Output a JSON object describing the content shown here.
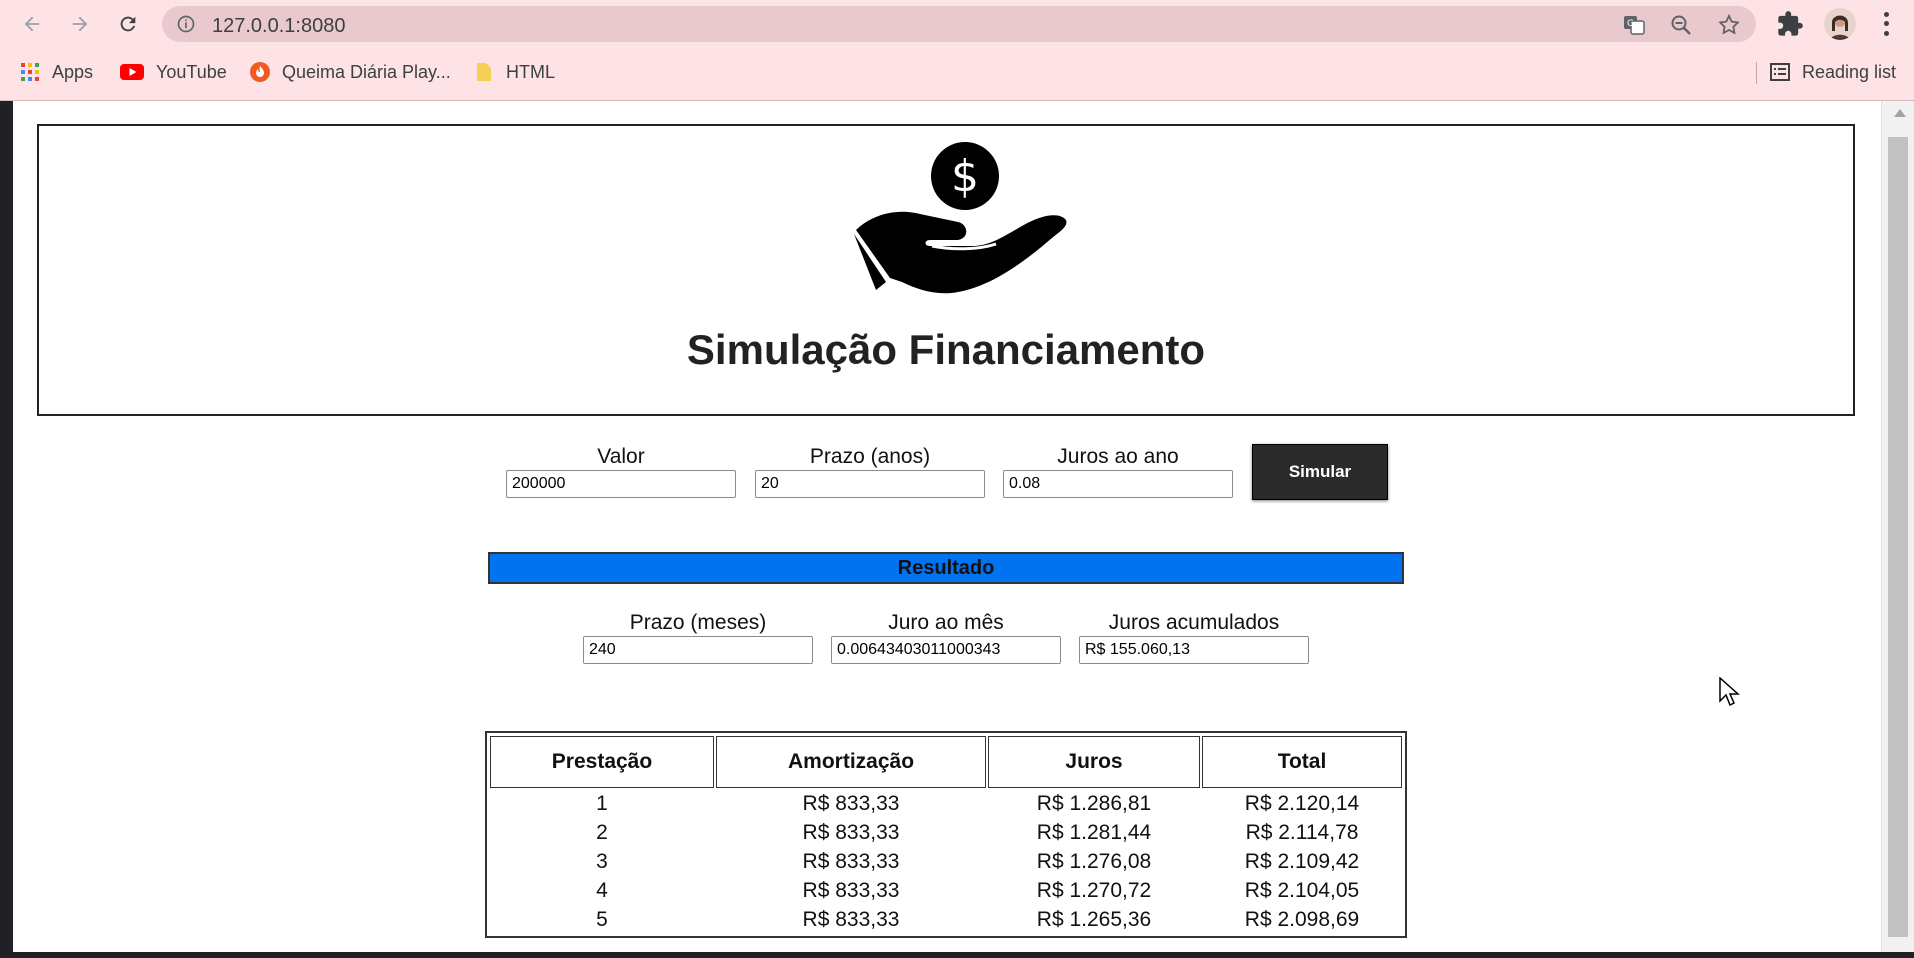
{
  "browser": {
    "url": "127.0.0.1:8080",
    "bookmarks": [
      {
        "label": "Apps",
        "icon": "apps-grid-icon"
      },
      {
        "label": "YouTube",
        "icon": "youtube-icon"
      },
      {
        "label": "Queima Diária Play...",
        "icon": "flame-icon"
      },
      {
        "label": "HTML",
        "icon": "folder-icon"
      }
    ],
    "reading_list": "Reading list"
  },
  "header": {
    "title": "Simulação Financiamento",
    "icon": "hand-money-icon"
  },
  "form": {
    "valor": {
      "label": "Valor",
      "value": "200000"
    },
    "prazo_anos": {
      "label": "Prazo (anos)",
      "value": "20"
    },
    "juros_ano": {
      "label": "Juros ao ano",
      "value": "0.08"
    },
    "submit_label": "Simular"
  },
  "resultado": {
    "title": "Resultado",
    "prazo_meses": {
      "label": "Prazo (meses)",
      "value": "240"
    },
    "juro_mes": {
      "label": "Juro ao mês",
      "value": "0.00643403011000343"
    },
    "juros_acumulados": {
      "label": "Juros acumulados",
      "value": "R$ 155.060,13"
    }
  },
  "table": {
    "headers": [
      "Prestação",
      "Amortização",
      "Juros",
      "Total"
    ],
    "rows": [
      [
        "1",
        "R$ 833,33",
        "R$ 1.286,81",
        "R$ 2.120,14"
      ],
      [
        "2",
        "R$ 833,33",
        "R$ 1.281,44",
        "R$ 2.114,78"
      ],
      [
        "3",
        "R$ 833,33",
        "R$ 1.276,08",
        "R$ 2.109,42"
      ],
      [
        "4",
        "R$ 833,33",
        "R$ 1.270,72",
        "R$ 2.104,05"
      ],
      [
        "5",
        "R$ 833,33",
        "R$ 1.265,36",
        "R$ 2.098,69"
      ]
    ]
  }
}
